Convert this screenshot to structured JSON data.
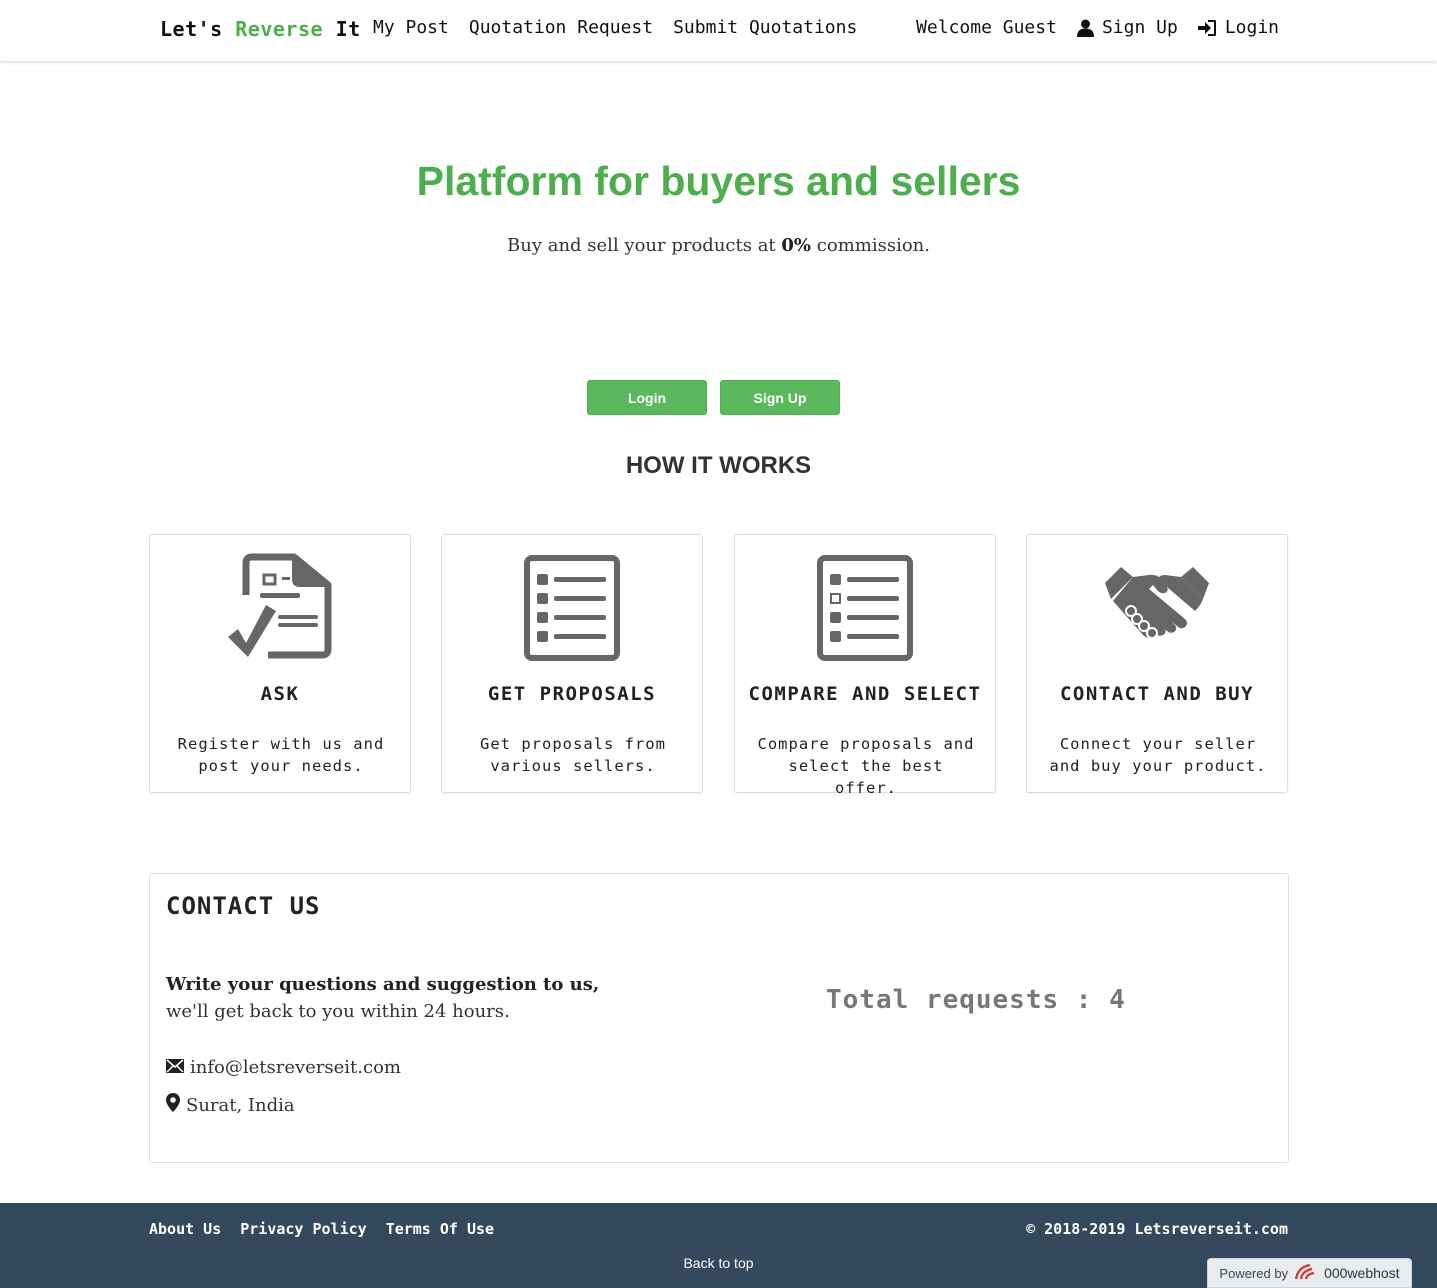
{
  "navbar": {
    "brand": {
      "part1": "Let's",
      "part2": "Reverse",
      "part3": "It"
    },
    "links": [
      "My Post",
      "Quotation Request",
      "Submit Quotations"
    ],
    "welcome": "Welcome Guest",
    "signup": "Sign Up",
    "login": "Login",
    "icons": {
      "signup": "user-icon",
      "login": "login-icon"
    }
  },
  "hero": {
    "title": "Platform for buyers and sellers",
    "subtitle_pre": "Buy and sell your products at",
    "subtitle_bold": "0%",
    "subtitle_post": "commission.",
    "login_button": "Login",
    "signup_button": "Sign Up"
  },
  "how_it_works": {
    "title": "HOW IT WORKS",
    "steps": [
      {
        "icon": "document-check-icon",
        "title": "ASK",
        "description": "Register with us and post your needs."
      },
      {
        "icon": "list-icon",
        "title": "GET PROPOSALS",
        "description": "Get proposals from various sellers."
      },
      {
        "icon": "checklist-icon",
        "title": "COMPARE AND SELECT",
        "description": "Compare proposals and select the best offer."
      },
      {
        "icon": "handshake-icon",
        "title": "CONTACT AND BUY",
        "description": "Connect your seller and buy your product."
      }
    ]
  },
  "contact": {
    "title": "CONTACT US",
    "lead": "Write your questions and suggestion to us,",
    "lead2": "we'll get back to you within 24 hours.",
    "email": "info@letsreverseit.com",
    "location": "Surat, India",
    "total_requests": "Total requests : 4"
  },
  "footer": {
    "links": [
      "About Us",
      "Privacy Policy",
      "Terms Of Use"
    ],
    "copyright": "© 2018-2019 Letsreverseit.com",
    "back_to_top": "Back to top",
    "powered_by": "Powered by",
    "host": "000webhost"
  },
  "colors": {
    "brand_green": "#4cae4c",
    "button_green": "#5cb85c",
    "footer_bg": "#34495e",
    "icon_gray": "#666666"
  }
}
